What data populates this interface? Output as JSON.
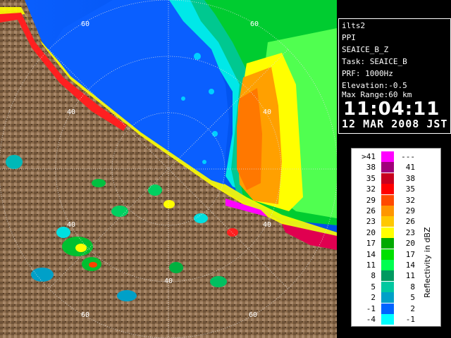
{
  "info": {
    "station": "ilts2",
    "scan_type": "PPI",
    "product": "SEAICE_B_Z",
    "task": "Task: SEAICE_B",
    "prf": "PRF: 1000Hz",
    "elevation": "Elevation:-0.5",
    "max_range": "Max Range:60 km",
    "time": "11:04:11",
    "date": "12 MAR 2008 JST"
  },
  "legend": {
    "title": "Reflectivity in dBZ",
    "rows": [
      {
        "left": ">41",
        "right": "---",
        "color": "#ff00ff"
      },
      {
        "left": "38",
        "right": "41",
        "color": "#a0007a"
      },
      {
        "left": "35",
        "right": "38",
        "color": "#c8001e"
      },
      {
        "left": "32",
        "right": "35",
        "color": "#ff0000"
      },
      {
        "left": "29",
        "right": "32",
        "color": "#ff4a00"
      },
      {
        "left": "26",
        "right": "29",
        "color": "#ff9600"
      },
      {
        "left": "23",
        "right": "26",
        "color": "#ffc800"
      },
      {
        "left": "20",
        "right": "23",
        "color": "#ffff00"
      },
      {
        "left": "17",
        "right": "20",
        "color": "#00aa00"
      },
      {
        "left": "14",
        "right": "17",
        "color": "#00e000"
      },
      {
        "left": "11",
        "right": "14",
        "color": "#00ff50"
      },
      {
        "left": "8",
        "right": "11",
        "color": "#009a60"
      },
      {
        "left": "5",
        "right": "8",
        "color": "#00c8a0"
      },
      {
        "left": "2",
        "right": "5",
        "color": "#00a0c8"
      },
      {
        "left": "-1",
        "right": "2",
        "color": "#0064ff"
      },
      {
        "left": "-4",
        "right": "-1",
        "color": "#00ffff"
      }
    ]
  },
  "range_labels": {
    "r40_top": "40",
    "r40_left": "40",
    "r40_bottom": "40",
    "r40_right": "40",
    "r60_top_left": "60",
    "r60_top_right": "60",
    "r60_bottom_left": "60",
    "r60_bottom_right": "60"
  },
  "colors": {
    "sea": "#0066ff",
    "land": "#8a6a4a",
    "background": "#000000"
  }
}
